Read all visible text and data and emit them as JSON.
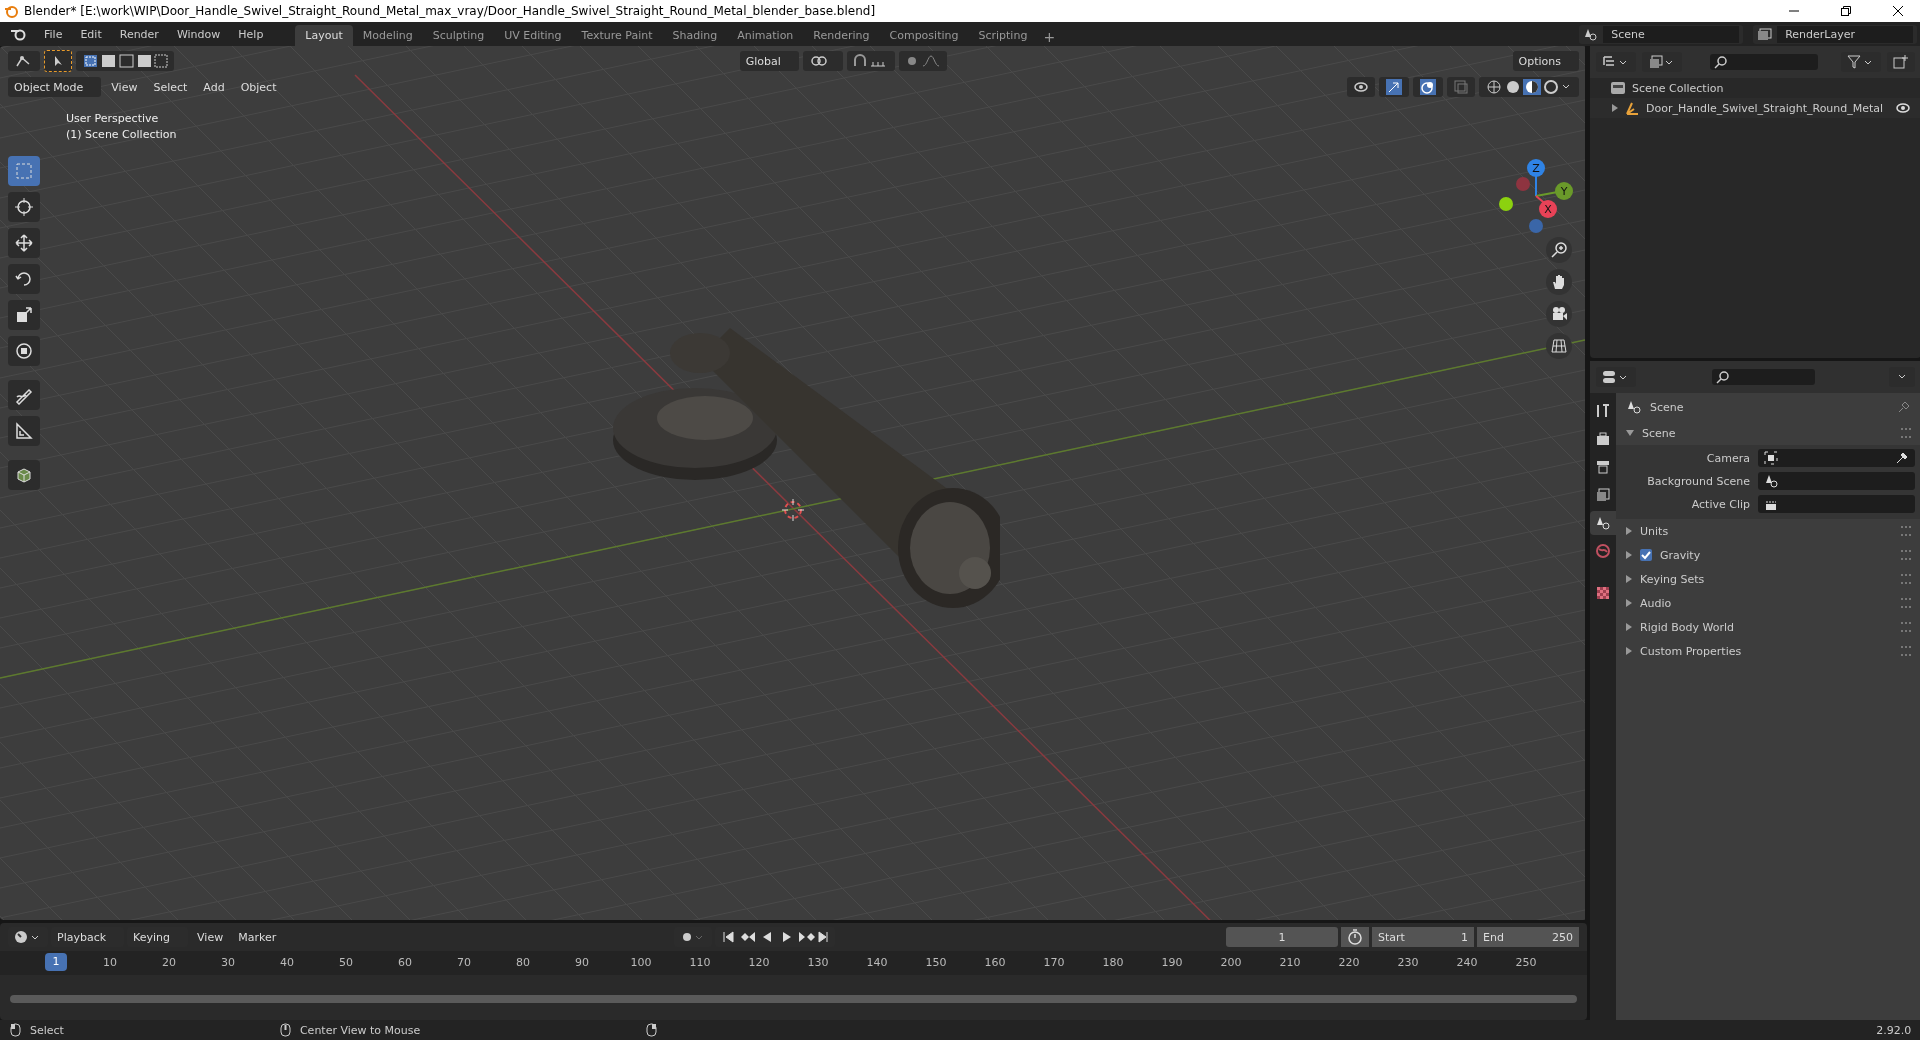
{
  "window": {
    "title": "Blender* [E:\\work\\WIP\\Door_Handle_Swivel_Straight_Round_Metal_max_vray/Door_Handle_Swivel_Straight_Round_Metal_blender_base.blend]"
  },
  "menu": [
    "File",
    "Edit",
    "Render",
    "Window",
    "Help"
  ],
  "workspaces": [
    {
      "label": "Layout",
      "selected": true
    },
    {
      "label": "Modeling",
      "selected": false
    },
    {
      "label": "Sculpting",
      "selected": false
    },
    {
      "label": "UV Editing",
      "selected": false
    },
    {
      "label": "Texture Paint",
      "selected": false
    },
    {
      "label": "Shading",
      "selected": false
    },
    {
      "label": "Animation",
      "selected": false
    },
    {
      "label": "Rendering",
      "selected": false
    },
    {
      "label": "Compositing",
      "selected": false
    },
    {
      "label": "Scripting",
      "selected": false
    }
  ],
  "add_workspace": "+",
  "scene_selector": {
    "scene": "Scene",
    "view_layer": "RenderLayer"
  },
  "viewport": {
    "mode": "Object Mode",
    "menus": [
      "View",
      "Select",
      "Add",
      "Object"
    ],
    "orientation": "Global",
    "options": "Options",
    "overlay_text": [
      "User Perspective",
      "(1) Scene Collection"
    ],
    "gizmo_axes": [
      "Z",
      "Y",
      "X"
    ],
    "tools": [
      {
        "selected": true
      },
      {
        "selected": false
      },
      {
        "selected": false
      },
      {
        "selected": false
      },
      {
        "selected": false
      },
      {
        "selected": false
      },
      {
        "selected": false
      },
      {
        "selected": false
      },
      {
        "selected": false
      }
    ]
  },
  "outliner": {
    "items": [
      {
        "label": "Scene Collection",
        "children": [
          {
            "label": "Door_Handle_Swivel_Straight_Round_Metal",
            "expanded": false
          }
        ]
      }
    ]
  },
  "properties": {
    "tabs": [
      {
        "selected": false
      },
      {
        "selected": false
      },
      {
        "selected": false
      },
      {
        "selected": false
      },
      {
        "selected": true
      },
      {
        "selected": false
      },
      {
        "selected": false
      }
    ],
    "context": "Scene",
    "panel": {
      "title": "Scene",
      "expanded": true,
      "fields": [
        {
          "label": "Camera"
        },
        {
          "label": "Background Scene"
        },
        {
          "label": "Active Clip"
        }
      ]
    },
    "subpanels": [
      {
        "label": "Units",
        "expanded": false,
        "kind": "plain"
      },
      {
        "label": "Gravity",
        "expanded": false,
        "kind": "checkbox",
        "checked": true
      },
      {
        "label": "Keying Sets",
        "expanded": false,
        "kind": "plain"
      },
      {
        "label": "Audio",
        "expanded": false,
        "kind": "plain"
      },
      {
        "label": "Rigid Body World",
        "expanded": false,
        "kind": "plain"
      },
      {
        "label": "Custom Properties",
        "expanded": false,
        "kind": "plain"
      }
    ]
  },
  "timeline": {
    "menus": [
      "Playback",
      "Keying",
      "View",
      "Marker"
    ],
    "current_frame": "1",
    "start_label": "Start",
    "start": "1",
    "end_label": "End",
    "end": "250",
    "playhead": "1",
    "ticks": [
      "10",
      "20",
      "30",
      "40",
      "50",
      "60",
      "70",
      "80",
      "90",
      "100",
      "110",
      "120",
      "130",
      "140",
      "150",
      "160",
      "170",
      "180",
      "190",
      "200",
      "210",
      "220",
      "230",
      "240",
      "250"
    ]
  },
  "status_bar": {
    "left": "Select",
    "middle": "Center View to Mouse",
    "version": "2.92.0"
  }
}
